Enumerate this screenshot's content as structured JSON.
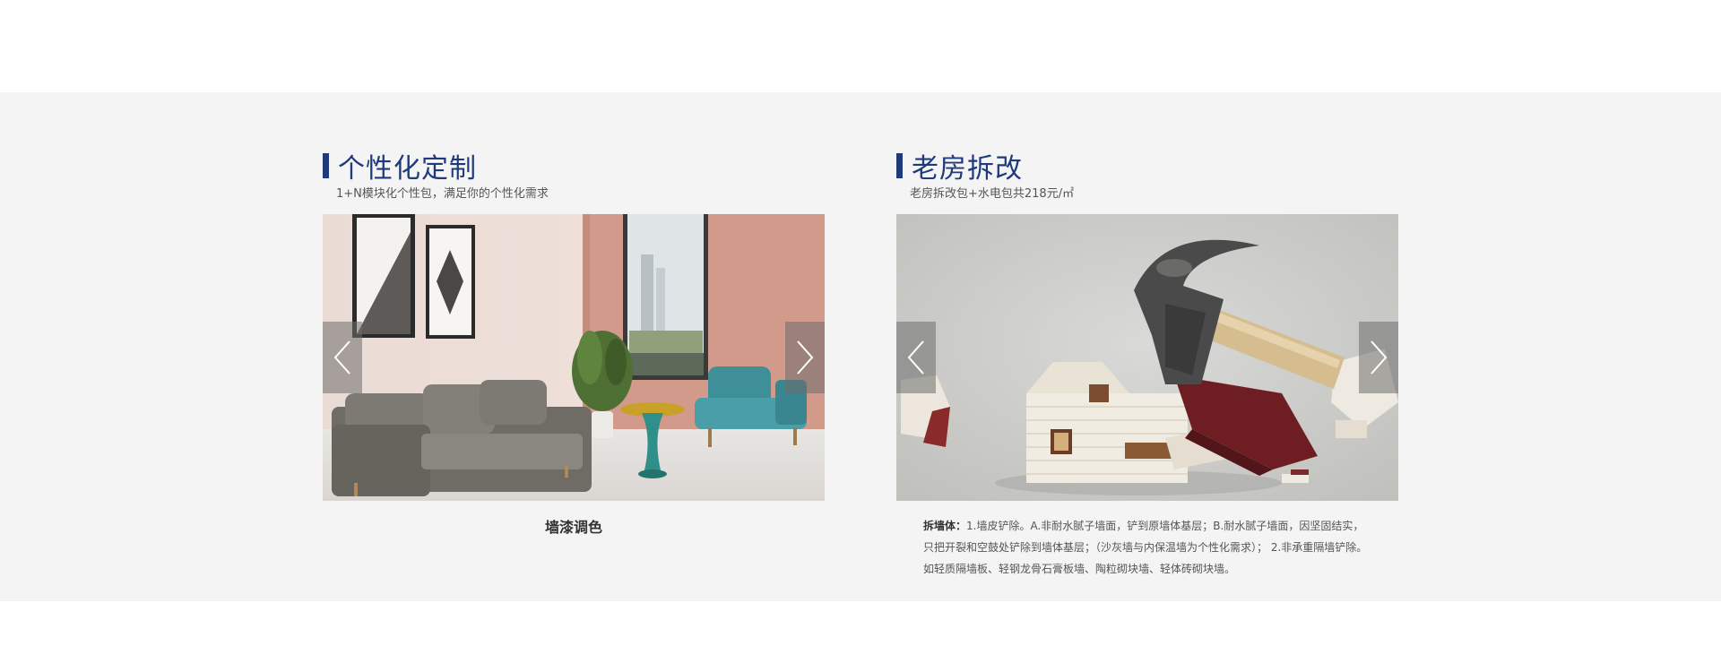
{
  "left": {
    "title": "个性化定制",
    "subtitle": "1+N模块化个性包，满足你的个性化需求",
    "caption": "墙漆调色"
  },
  "right": {
    "title": "老房拆改",
    "subtitle": "老房拆改包+水电包共218元/㎡",
    "desc_label": "拆墙体：",
    "desc_text": "1.墙皮铲除。A.非耐水腻子墙面，铲到原墙体基层；B.耐水腻子墙面，因坚固结实，只把开裂和空鼓处铲除到墙体基层；（沙灰墙与内保温墙为个性化需求）； 2.非承重隔墙铲除。如轻质隔墙板、轻钢龙骨石膏板墙、陶粒砌块墙、轻体砖砌块墙。"
  },
  "colors": {
    "accent": "#1f3a7a",
    "band_bg": "#f4f4f4"
  },
  "icons": {
    "prev": "chevron-left-icon",
    "next": "chevron-right-icon"
  }
}
